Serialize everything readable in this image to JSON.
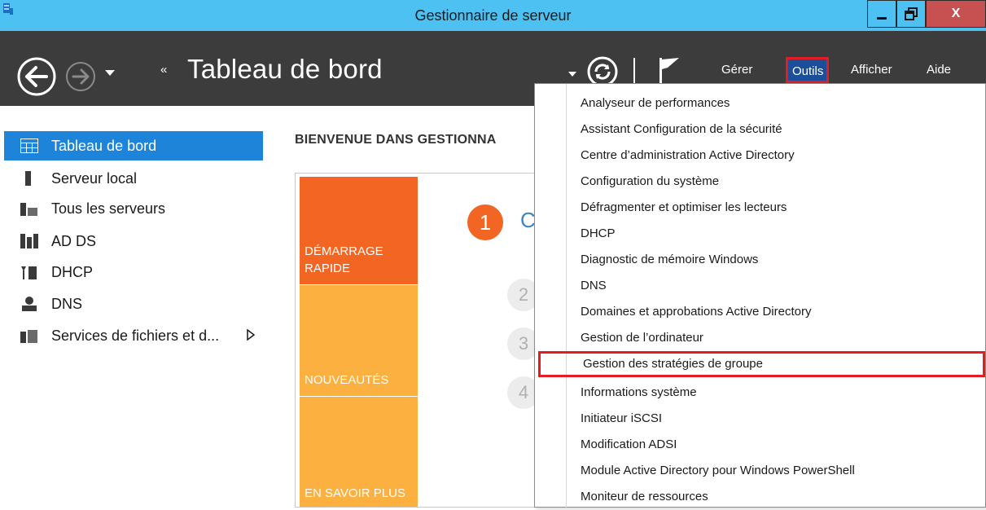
{
  "window": {
    "title": "Gestionnaire de serveur",
    "close_glyph": "X"
  },
  "header": {
    "breadcrumb_arrows": "«",
    "page_title": "Tableau de bord",
    "menu": {
      "gerer": "Gérer",
      "outils": "Outils",
      "afficher": "Afficher",
      "aide": "Aide"
    }
  },
  "sidebar": {
    "items": [
      {
        "label": "Tableau de bord",
        "icon": "dashboard-icon"
      },
      {
        "label": "Serveur local",
        "icon": "server-icon"
      },
      {
        "label": "Tous les serveurs",
        "icon": "servers-icon"
      },
      {
        "label": "AD DS",
        "icon": "ad-ds-icon"
      },
      {
        "label": "DHCP",
        "icon": "dhcp-icon"
      },
      {
        "label": "DNS",
        "icon": "dns-icon"
      },
      {
        "label": "Services de fichiers et d...",
        "icon": "file-services-icon"
      }
    ]
  },
  "main": {
    "welcome_title": "BIENVENUE DANS GESTIONNA",
    "tiles": {
      "quick_start_line1": "DÉMARRAGE",
      "quick_start_line2": "RAPIDE",
      "whats_new": "NOUVEAUTÉS",
      "learn_more": "EN SAVOIR PLUS"
    },
    "steps": {
      "step1": "1",
      "step1_label": "C",
      "step2": "2",
      "step3": "3",
      "step4": "4"
    }
  },
  "tools_menu": {
    "items": [
      "Analyseur de performances",
      "Assistant Configuration de la sécurité",
      "Centre d’administration Active Directory",
      "Configuration du système",
      "Défragmenter et optimiser les lecteurs",
      "DHCP",
      "Diagnostic de mémoire Windows",
      "DNS",
      "Domaines et approbations Active Directory",
      "Gestion de l’ordinateur",
      "Gestion des stratégies de groupe",
      "Informations système",
      "Initiateur iSCSI",
      "Modification ADSI",
      "Module Active Directory pour Windows PowerShell",
      "Moniteur de ressources"
    ],
    "highlighted_item": "Gestion des stratégies de groupe"
  },
  "colors": {
    "titlebar": "#4cc1f2",
    "header": "#3c3c3c",
    "accent": "#1e84d9",
    "highlight": "#e31b23",
    "tile_primary": "#f26522",
    "tile_secondary": "#fbb040"
  }
}
